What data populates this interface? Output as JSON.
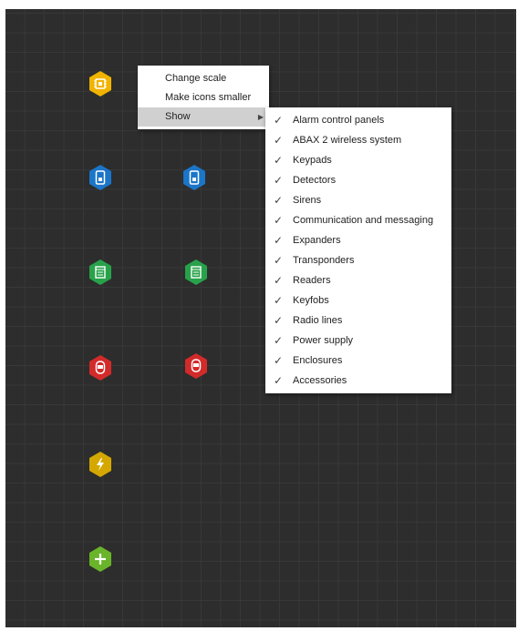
{
  "canvas": {
    "background": "#2d2d2d",
    "grid_color": "#383838"
  },
  "nodes": [
    {
      "name": "alarm-panel-node",
      "icon": "chip-icon",
      "color": "#f0b400",
      "label": ""
    },
    {
      "name": "keypad-node-1",
      "icon": "keypad-icon",
      "color": "#1b75c8",
      "label": ""
    },
    {
      "name": "keypad-node-2",
      "icon": "keypad-icon",
      "color": "#1b75c8",
      "label": ""
    },
    {
      "name": "expander-node-1",
      "icon": "expander-icon",
      "color": "#28a24a",
      "label": ""
    },
    {
      "name": "expander-node-2",
      "icon": "expander-icon",
      "color": "#28a24a",
      "label": ""
    },
    {
      "name": "detector-node-1",
      "icon": "detector-icon",
      "color": "#d32a2a",
      "label": ""
    },
    {
      "name": "detector-node-2",
      "icon": "detector-icon",
      "color": "#d32a2a",
      "label": ""
    },
    {
      "name": "power-supply-node",
      "icon": "lightning-icon",
      "color": "#d4a800",
      "label": ""
    },
    {
      "name": "add-node",
      "icon": "plus-icon",
      "color": "#6ab42a",
      "label": ""
    }
  ],
  "context_menu": {
    "items": [
      {
        "label": "Change scale"
      },
      {
        "label": "Make icons smaller"
      },
      {
        "label": "Show",
        "submenu_arrow": "▶"
      }
    ]
  },
  "show_submenu": {
    "check_glyph": "✓",
    "items": [
      {
        "label": "Alarm control panels",
        "checked": true
      },
      {
        "label": "ABAX 2 wireless system",
        "checked": true
      },
      {
        "label": "Keypads",
        "checked": true
      },
      {
        "label": "Detectors",
        "checked": true
      },
      {
        "label": "Sirens",
        "checked": true
      },
      {
        "label": "Communication and messaging",
        "checked": true
      },
      {
        "label": "Expanders",
        "checked": true
      },
      {
        "label": "Transponders",
        "checked": true
      },
      {
        "label": "Readers",
        "checked": true
      },
      {
        "label": "Keyfobs",
        "checked": true
      },
      {
        "label": "Radio lines",
        "checked": true
      },
      {
        "label": "Power supply",
        "checked": true
      },
      {
        "label": "Enclosures",
        "checked": true
      },
      {
        "label": "Accessories",
        "checked": true
      }
    ]
  }
}
